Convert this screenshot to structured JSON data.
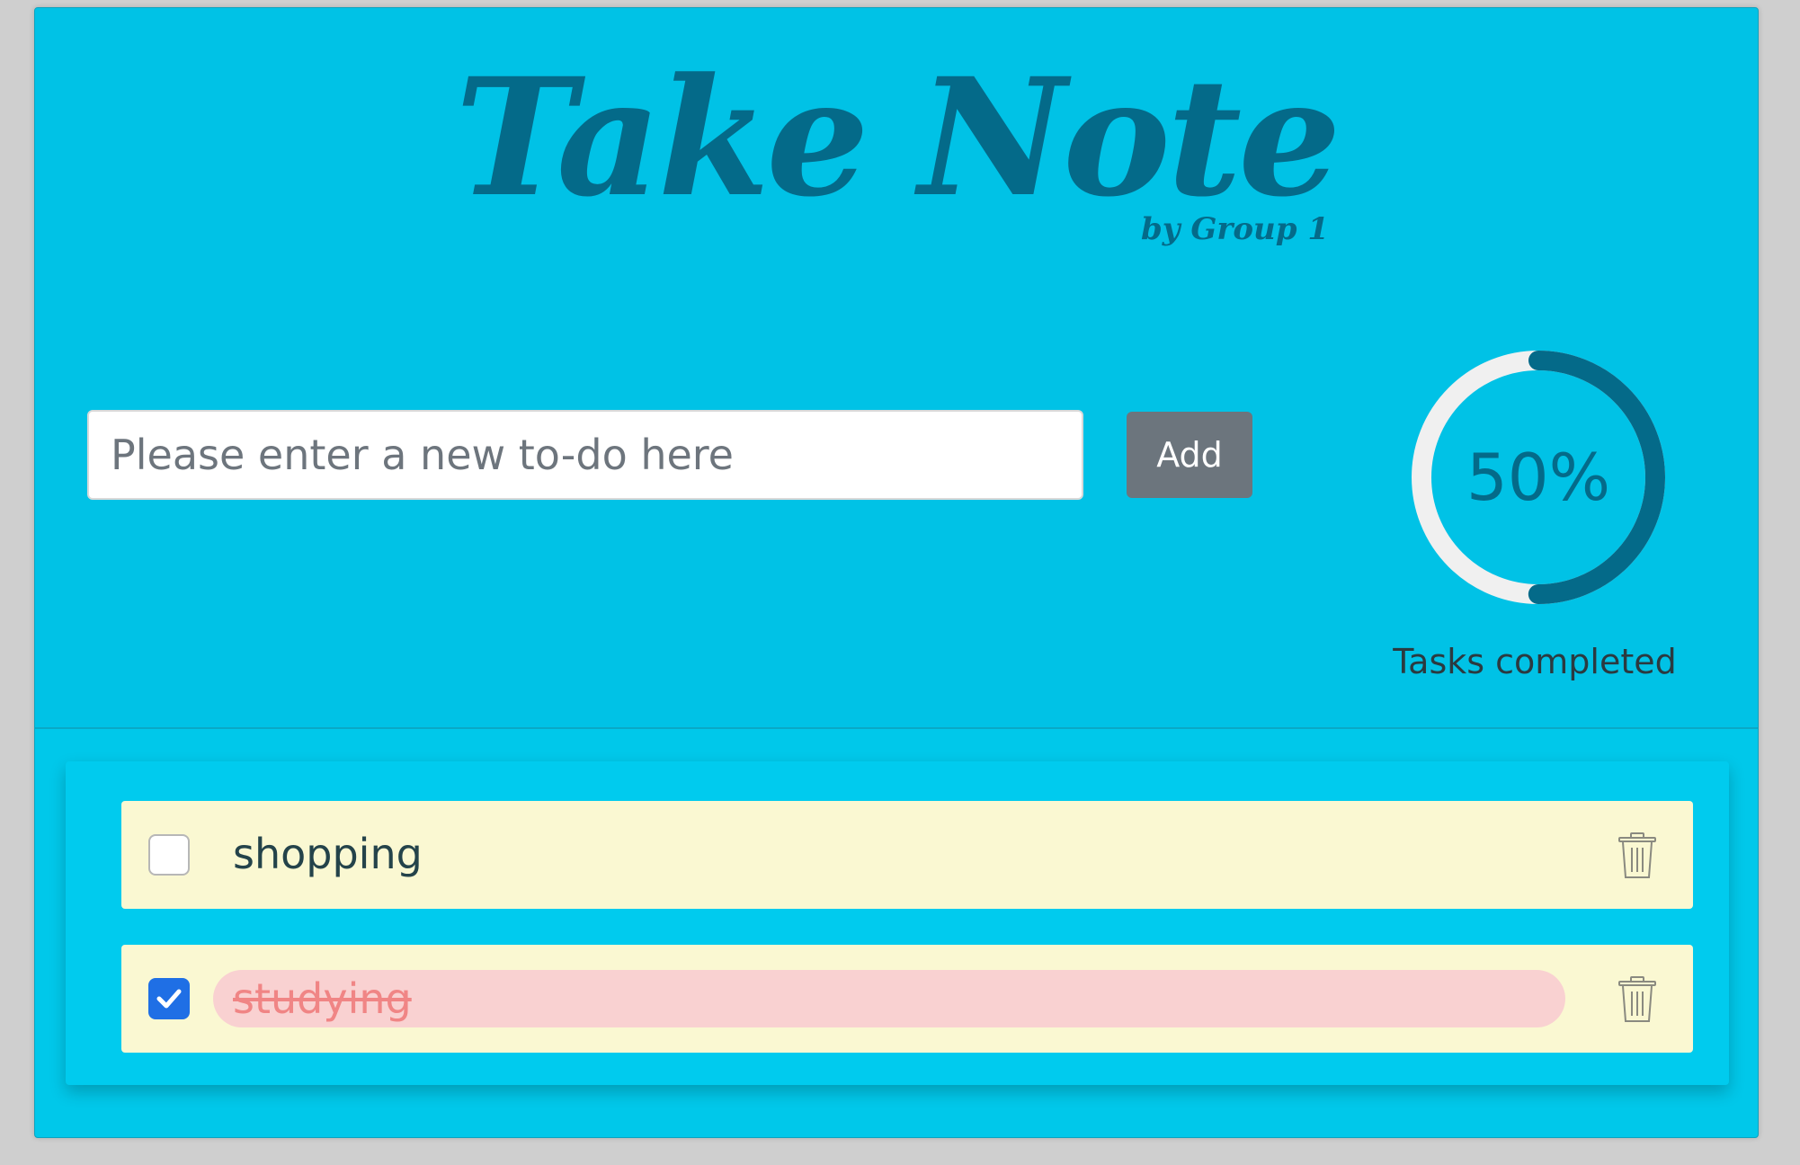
{
  "header": {
    "title": "Take Note",
    "subtitle": "by Group 1"
  },
  "input": {
    "placeholder": "Please enter a new to-do here",
    "value": ""
  },
  "add_button": {
    "label": "Add"
  },
  "progress": {
    "percent_text": "50%",
    "fraction": 0.5,
    "label": "Tasks completed"
  },
  "todos": [
    {
      "text": "shopping",
      "done": false,
      "delete_icon": "trash-icon"
    },
    {
      "text": "studying",
      "done": true,
      "delete_icon": "trash-icon"
    }
  ],
  "colors": {
    "background": "#00c2e6",
    "title": "#046a89",
    "ring_track": "#f0f0f0",
    "ring_fill": "#046a89",
    "item_bg": "#faf8d2",
    "done_bg": "#f9d1d1",
    "done_text": "#f08585",
    "checkbox_checked": "#1f6fe5",
    "button": "#6c757d"
  }
}
